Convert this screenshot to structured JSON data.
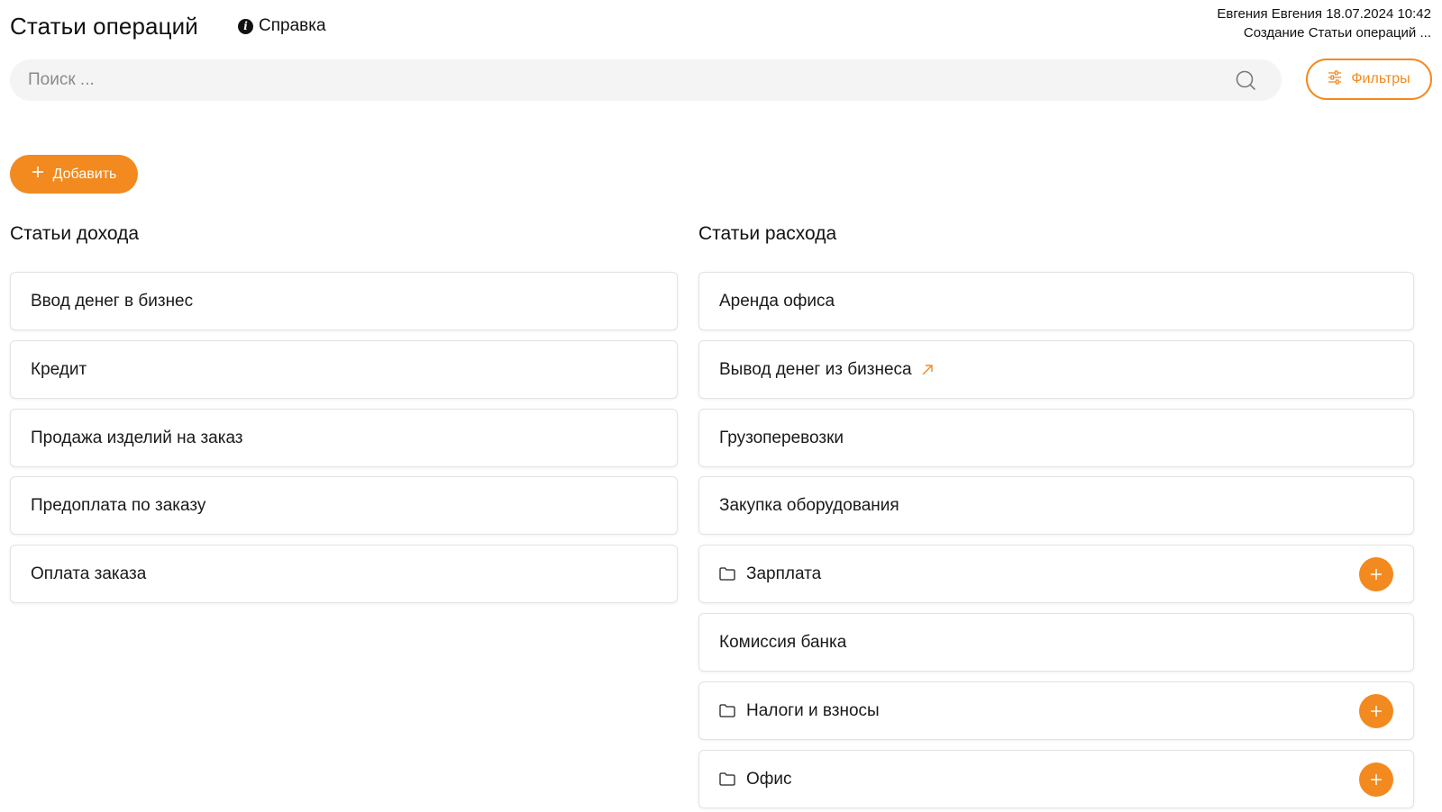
{
  "header": {
    "title": "Статьи операций",
    "help_label": "Справка",
    "user_line": "Евгения Евгения 18.07.2024 10:42",
    "context_line": "Создание Статьи операций ..."
  },
  "search": {
    "placeholder": "Поиск ..."
  },
  "filters_label": "Фильтры",
  "add_label": "Добавить",
  "income": {
    "title": "Статьи дохода",
    "items": [
      {
        "label": "Ввод денег в бизнес"
      },
      {
        "label": "Кредит"
      },
      {
        "label": "Продажа изделий на заказ"
      },
      {
        "label": "Предоплата по заказу"
      },
      {
        "label": "Оплата заказа"
      }
    ]
  },
  "expense": {
    "title": "Статьи расхода",
    "items": [
      {
        "label": "Аренда офиса",
        "type": "item"
      },
      {
        "label": "Вывод денег из бизнеса",
        "type": "link"
      },
      {
        "label": "Грузоперевозки",
        "type": "item"
      },
      {
        "label": "Закупка оборудования",
        "type": "item"
      },
      {
        "label": "Зарплата",
        "type": "folder"
      },
      {
        "label": "Комиссия банка",
        "type": "item"
      },
      {
        "label": "Налоги и взносы",
        "type": "folder"
      },
      {
        "label": "Офис",
        "type": "folder"
      }
    ]
  },
  "colors": {
    "accent": "#f28a1f",
    "card_border": "#e3e3e3",
    "search_bg": "#f4f4f4"
  }
}
